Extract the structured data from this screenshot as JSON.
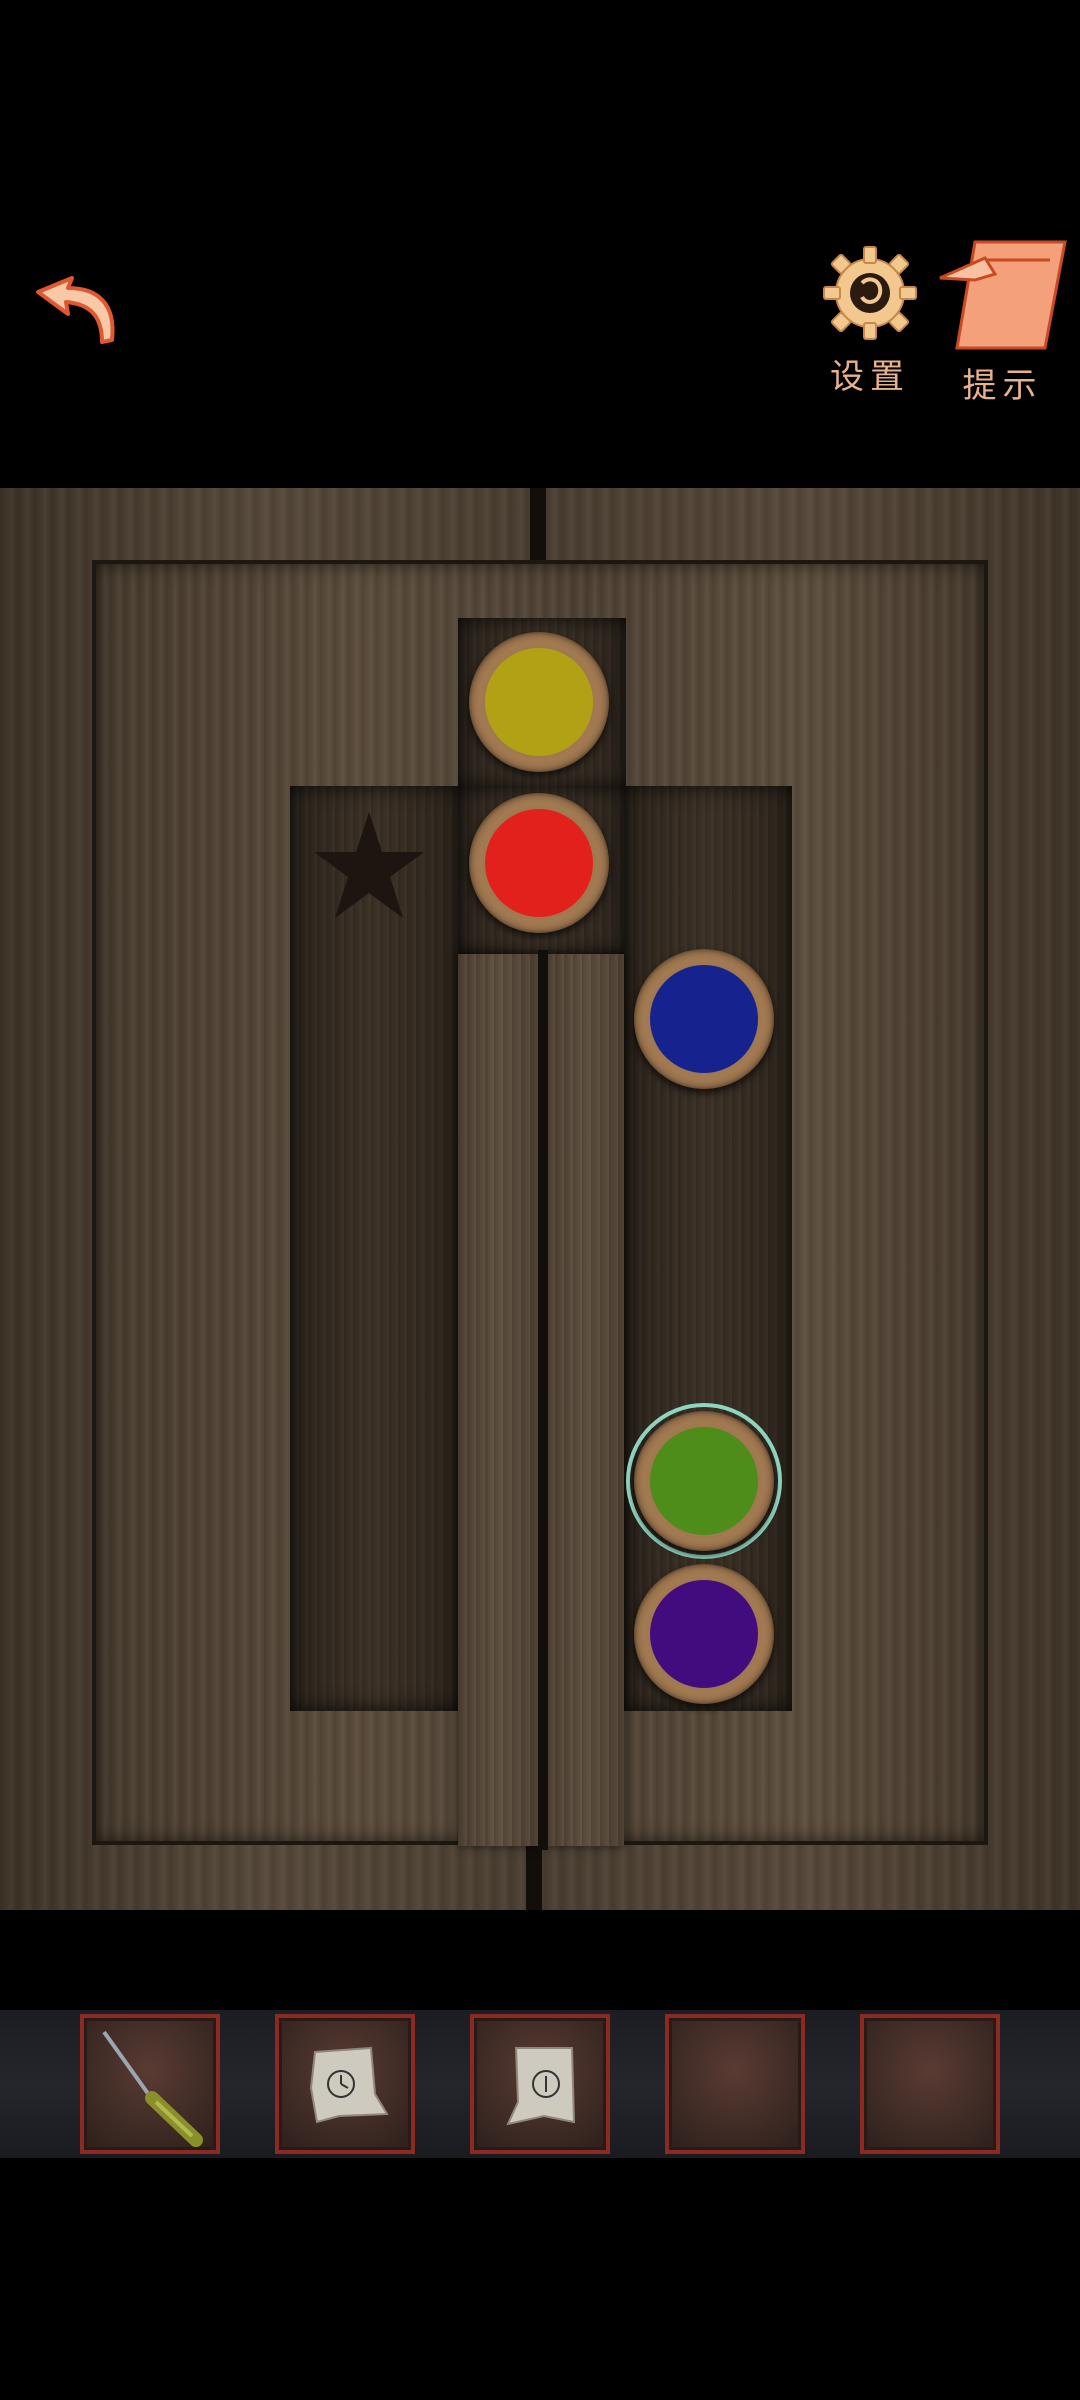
{
  "header": {
    "back_icon": "back-arrow-icon",
    "settings_label": "设置",
    "settings_icon": "gear-icon",
    "hint_label": "提示",
    "hint_icon": "paper-note-icon"
  },
  "puzzle": {
    "star_icon": "star-icon",
    "balls": [
      {
        "name": "yellow",
        "color": "#b2a115"
      },
      {
        "name": "red",
        "color": "#e2211c"
      },
      {
        "name": "blue",
        "color": "#16238f"
      },
      {
        "name": "green",
        "color": "#4e8d1a",
        "selected": true
      },
      {
        "name": "purple",
        "color": "#420c7e"
      }
    ]
  },
  "inventory": {
    "slots": [
      {
        "item": "screwdriver"
      },
      {
        "item": "paper-clock-fragment"
      },
      {
        "item": "paper-clock-fragment"
      },
      {
        "item": ""
      },
      {
        "item": ""
      }
    ]
  },
  "colors": {
    "accent": "#f08a5a",
    "label": "#e8b28a",
    "slot_border": "#8b2a22"
  }
}
